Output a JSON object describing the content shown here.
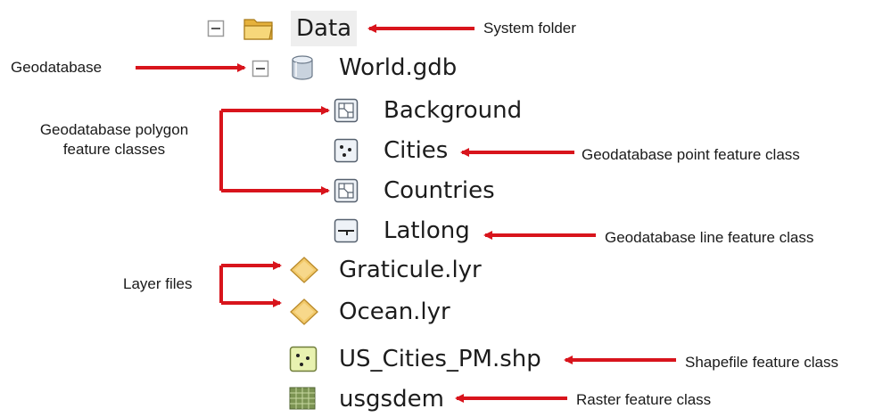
{
  "tree": {
    "data_folder": "Data",
    "world_gdb": "World.gdb",
    "background": "Background",
    "cities": "Cities",
    "countries": "Countries",
    "latlong": "Latlong",
    "graticule": "Graticule.lyr",
    "ocean": "Ocean.lyr",
    "us_cities": "US_Cities_PM.shp",
    "usgsdem": "usgsdem"
  },
  "callouts": {
    "system_folder": "System folder",
    "geodatabase": "Geodatabase",
    "polygon_line1": "Geodatabase polygon",
    "polygon_line2": "feature classes",
    "point_fc": "Geodatabase point feature class",
    "line_fc": "Geodatabase line feature class",
    "layer_files": "Layer files",
    "shapefile_fc": "Shapefile feature class",
    "raster_fc": "Raster feature class"
  },
  "colors": {
    "arrow": "#d8141c",
    "folder": "#f0c85c",
    "layer_diamond": "#f2c96a",
    "shapefile": "#e8f2b0",
    "raster": "#6f8a4a"
  }
}
